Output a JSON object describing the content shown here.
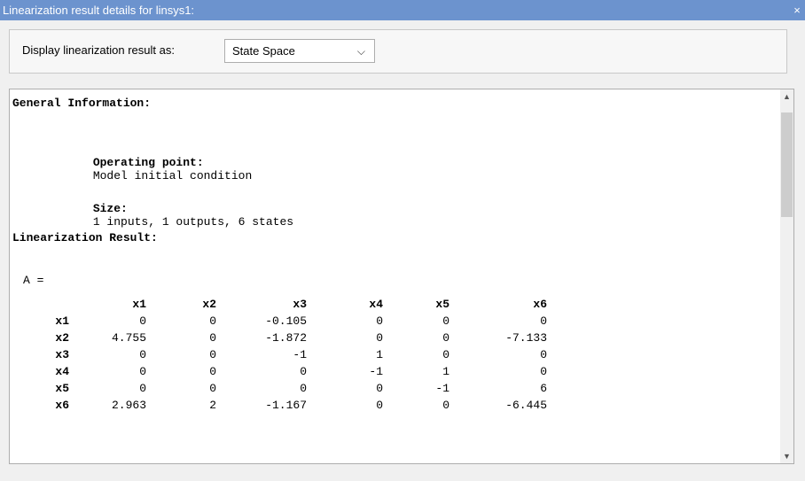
{
  "window": {
    "title": "Linearization result details for linsys1:",
    "close_glyph": "×"
  },
  "toolbar": {
    "display_label": "Display linearization result as:",
    "format_selected": "State Space",
    "chevron_glyph": "⌵"
  },
  "results": {
    "general_heading": "General Information:",
    "operating_point_label": "Operating point:",
    "operating_point_value": "Model initial condition",
    "size_label": "Size:",
    "size_value": "1 inputs, 1 outputs, 6 states",
    "linearization_heading": "Linearization Result:",
    "matrix_label": "A =",
    "columns": [
      "x1",
      "x2",
      "x3",
      "x4",
      "x5",
      "x6"
    ],
    "rows": [
      {
        "name": "x1",
        "values": [
          "0",
          "0",
          "-0.105",
          "0",
          "0",
          "0"
        ]
      },
      {
        "name": "x2",
        "values": [
          "4.755",
          "0",
          "-1.872",
          "0",
          "0",
          "-7.133"
        ]
      },
      {
        "name": "x3",
        "values": [
          "0",
          "0",
          "-1",
          "1",
          "0",
          "0"
        ]
      },
      {
        "name": "x4",
        "values": [
          "0",
          "0",
          "0",
          "-1",
          "1",
          "0"
        ]
      },
      {
        "name": "x5",
        "values": [
          "0",
          "0",
          "0",
          "0",
          "-1",
          "6"
        ]
      },
      {
        "name": "x6",
        "values": [
          "2.963",
          "2",
          "-1.167",
          "0",
          "0",
          "-6.445"
        ]
      }
    ]
  },
  "scrollbar": {
    "up_glyph": "▲",
    "down_glyph": "▼"
  }
}
